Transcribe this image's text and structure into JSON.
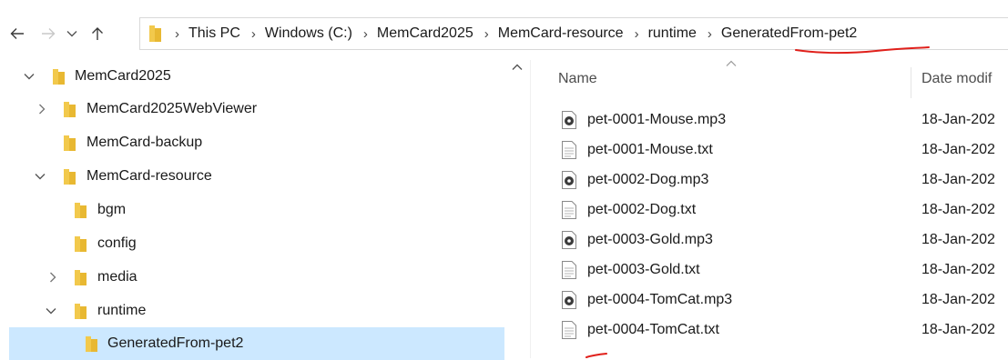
{
  "address_bar": {
    "breadcrumbs": [
      "This PC",
      "Windows (C:)",
      "MemCard2025",
      "MemCard-resource",
      "runtime",
      "GeneratedFrom-pet2"
    ]
  },
  "nav_tree": {
    "items": [
      {
        "label": "MemCard2025",
        "expanded": true
      },
      {
        "label": "MemCard2025WebViewer",
        "expanded": false
      },
      {
        "label": "MemCard-backup"
      },
      {
        "label": "MemCard-resource",
        "expanded": true
      },
      {
        "label": "bgm"
      },
      {
        "label": "config"
      },
      {
        "label": "media",
        "expanded": false
      },
      {
        "label": "runtime",
        "expanded": true
      },
      {
        "label": "GeneratedFrom-pet2",
        "selected": true
      }
    ]
  },
  "file_list": {
    "columns": {
      "name": "Name",
      "date": "Date modif"
    },
    "files": [
      {
        "name": "pet-0001-Mouse.mp3",
        "date": "18-Jan-202",
        "icon": "audio-file-icon"
      },
      {
        "name": "pet-0001-Mouse.txt",
        "date": "18-Jan-202",
        "icon": "text-file-icon"
      },
      {
        "name": "pet-0002-Dog.mp3",
        "date": "18-Jan-202",
        "icon": "audio-file-icon"
      },
      {
        "name": "pet-0002-Dog.txt",
        "date": "18-Jan-202",
        "icon": "text-file-icon"
      },
      {
        "name": "pet-0003-Gold.mp3",
        "date": "18-Jan-202",
        "icon": "audio-file-icon"
      },
      {
        "name": "pet-0003-Gold.txt",
        "date": "18-Jan-202",
        "icon": "text-file-icon"
      },
      {
        "name": "pet-0004-TomCat.mp3",
        "date": "18-Jan-202",
        "icon": "audio-file-icon"
      },
      {
        "name": "pet-0004-TomCat.txt",
        "date": "18-Jan-202",
        "icon": "text-file-icon"
      }
    ]
  },
  "colors": {
    "selection": "#cce8ff",
    "folder": "#e8b832",
    "annotation": "#e0201b"
  }
}
